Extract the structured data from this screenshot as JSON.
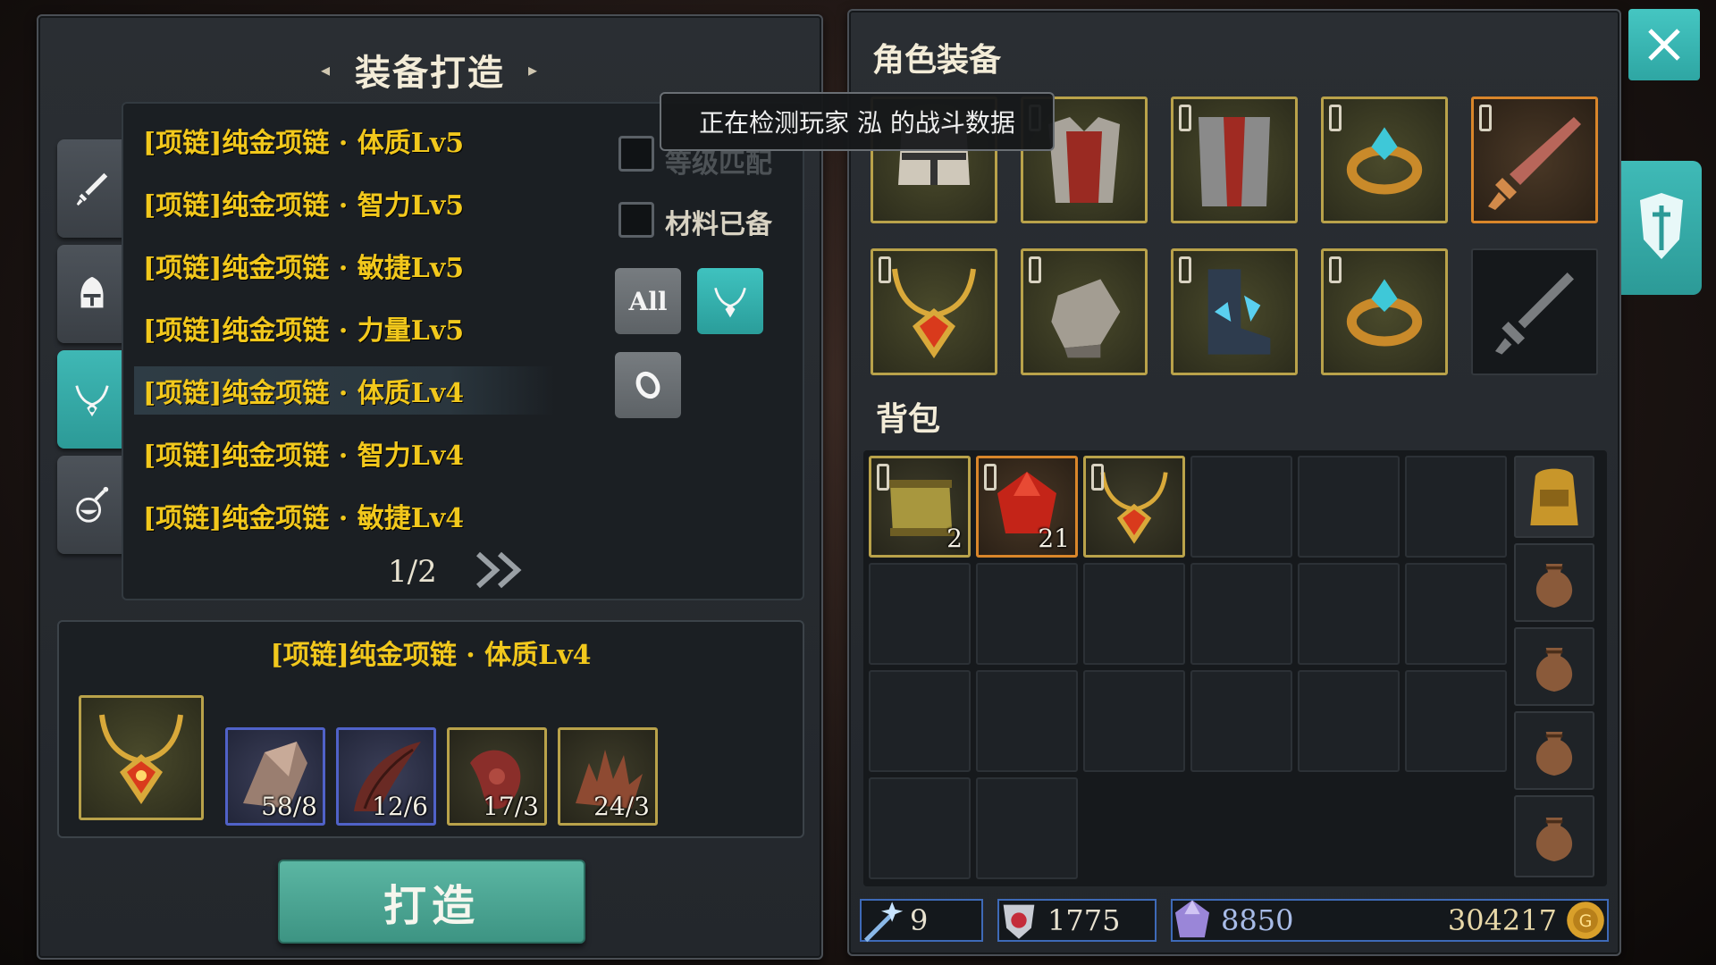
{
  "crafting": {
    "title": "装备打造",
    "tabs": [
      {
        "name": "weapon",
        "icon": "sword-icon",
        "active": false
      },
      {
        "name": "armor",
        "icon": "helmet-icon",
        "active": false
      },
      {
        "name": "necklace",
        "icon": "necklace-icon",
        "active": true
      },
      {
        "name": "potion",
        "icon": "potion-icon",
        "active": false
      }
    ],
    "recipes": [
      "[项链]纯金项链 · 体质Lv5",
      "[项链]纯金项链 · 智力Lv5",
      "[项链]纯金项链 · 敏捷Lv5",
      "[项链]纯金项链 · 力量Lv5",
      "[项链]纯金项链 · 体质Lv4",
      "[项链]纯金项链 · 智力Lv4",
      "[项链]纯金项链 · 敏捷Lv4"
    ],
    "selected_recipe_index": 4,
    "filters": {
      "level_match_label": "等级匹配",
      "materials_ready_label": "材料已备",
      "all_label": "All"
    },
    "pager": {
      "text": "1/2",
      "next_icon": "double-chevron-right-icon"
    },
    "detail": {
      "title": "[项链]纯金项链 · 体质Lv4",
      "result_icon": "gold-necklace-icon",
      "materials": [
        {
          "icon": "stone-shard-icon",
          "count": "58/8"
        },
        {
          "icon": "dark-horn-icon",
          "count": "12/6"
        },
        {
          "icon": "red-claw-icon",
          "count": "17/3"
        },
        {
          "icon": "spiky-shell-icon",
          "count": "24/3"
        }
      ]
    },
    "craft_button": "打造"
  },
  "tooltip": "正在检测玩家 泓 的战斗数据",
  "character": {
    "equipment_title": "角色装备",
    "equipment": [
      {
        "icon": "knight-helmet-icon"
      },
      {
        "icon": "red-chest-armor-icon"
      },
      {
        "icon": "red-leg-armor-icon"
      },
      {
        "icon": "gold-ring-icon"
      },
      {
        "icon": "crystal-sword-icon"
      },
      {
        "icon": "gold-necklace-icon"
      },
      {
        "icon": "leather-gloves-icon"
      },
      {
        "icon": "crystal-boots-icon"
      },
      {
        "icon": "gold-ring-icon"
      },
      {
        "icon": "empty-weapon-slot-icon"
      }
    ],
    "backpack_title": "背包",
    "backpack_items": [
      {
        "icon": "scroll-icon",
        "count": "2"
      },
      {
        "icon": "red-gem-icon",
        "count": "21"
      },
      {
        "icon": "gold-necklace-icon",
        "count": ""
      }
    ],
    "bag_tabs": [
      "backpack-icon",
      "pouch-icon",
      "pouch-icon",
      "pouch-icon",
      "pouch-icon"
    ],
    "currencies": {
      "wand": "9",
      "honor": "1775",
      "crystal": "8850",
      "gold": "304217"
    }
  },
  "colors": {
    "accent_teal": "#3fb8b5",
    "recipe_text": "#f2c81c",
    "craft_button": "#4ea593"
  }
}
